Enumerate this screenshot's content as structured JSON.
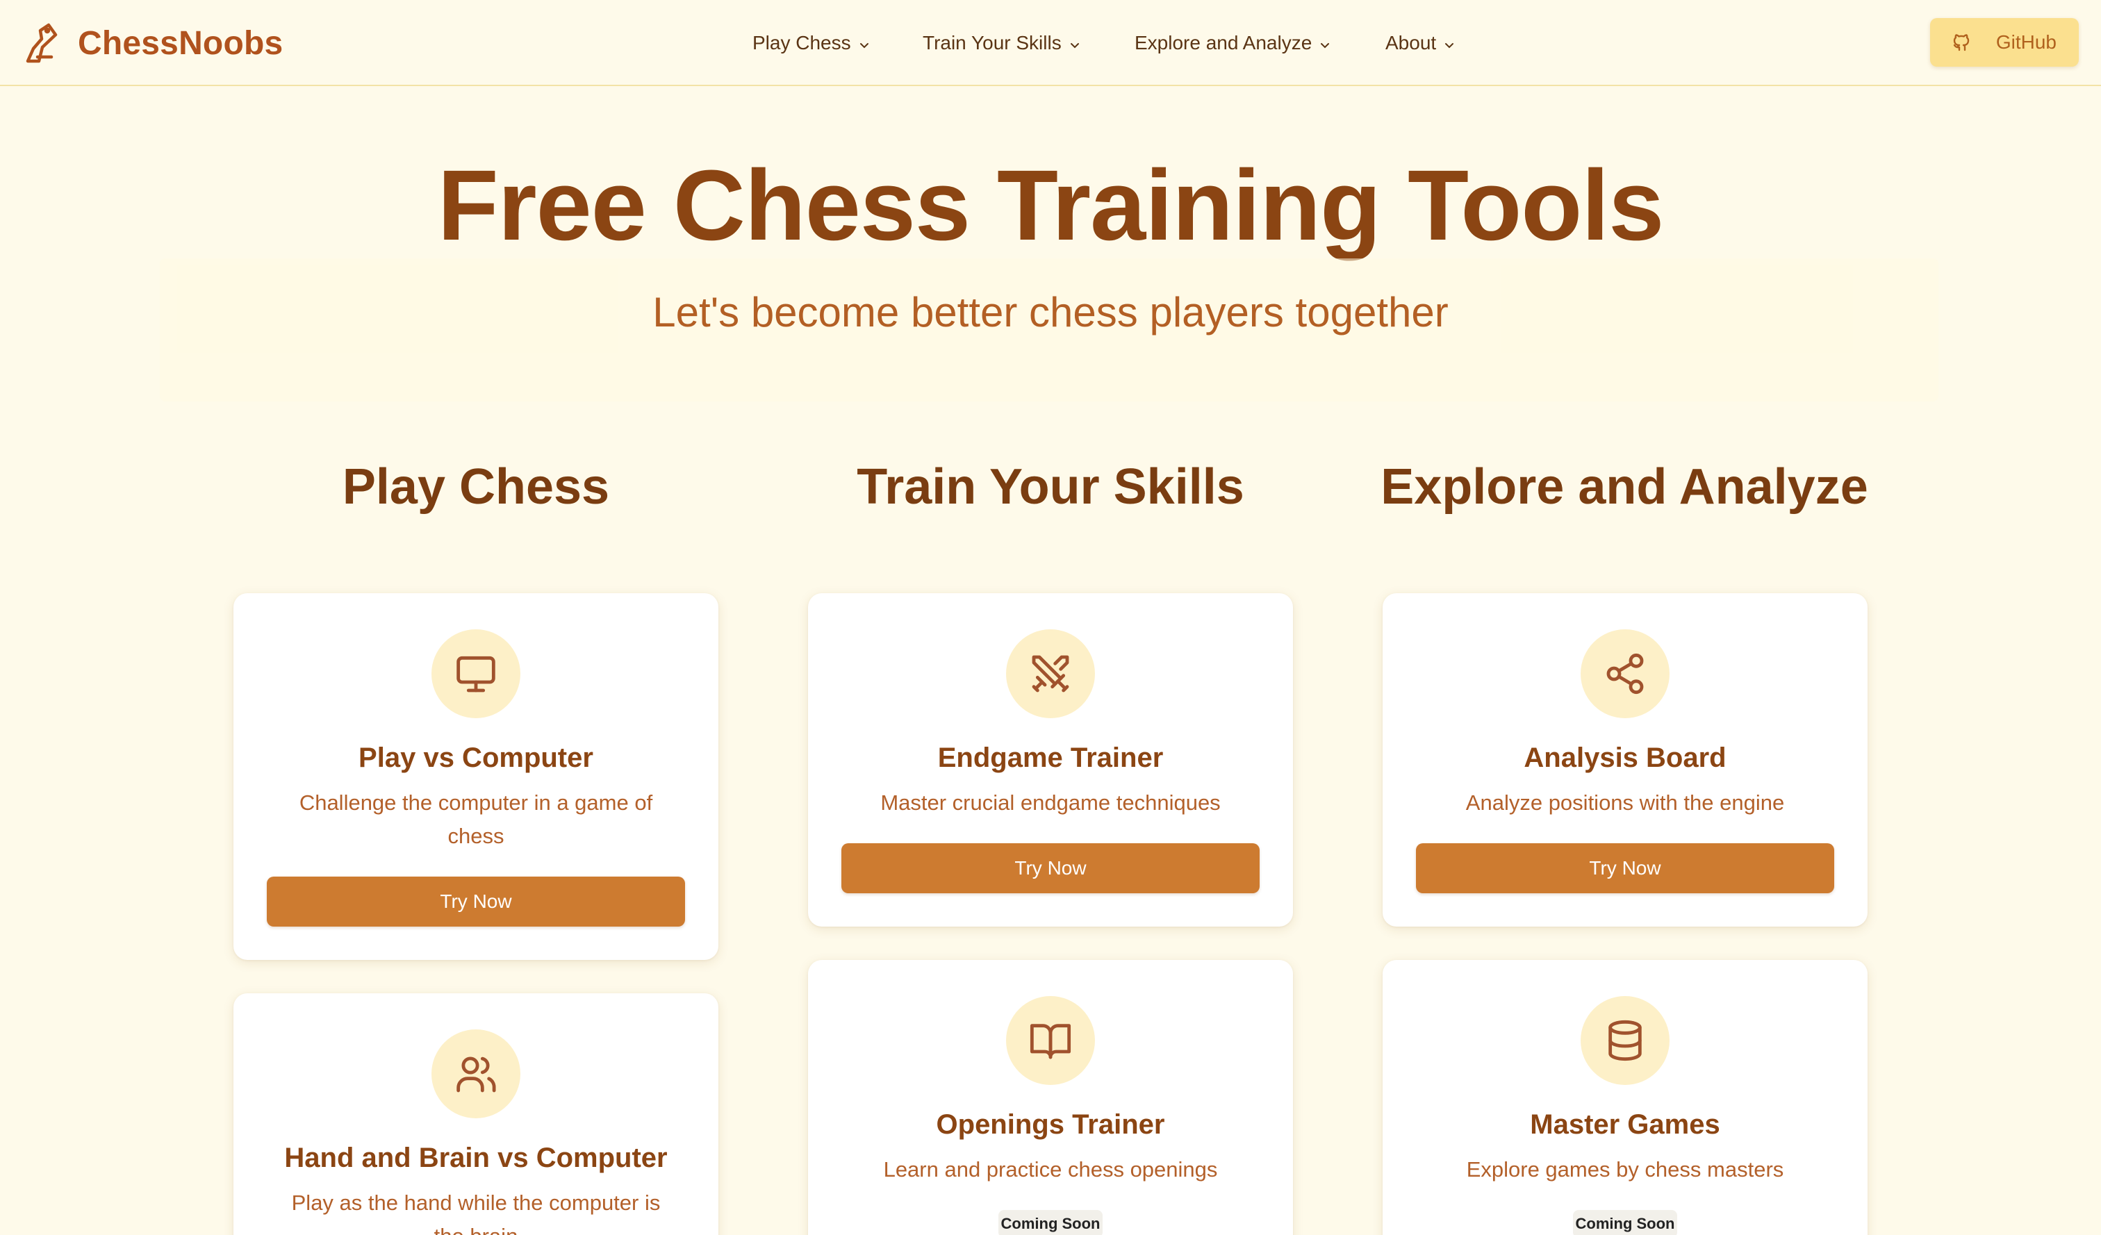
{
  "brand": {
    "name": "ChessNoobs"
  },
  "nav": {
    "items": [
      {
        "label": "Play Chess"
      },
      {
        "label": "Train Your Skills"
      },
      {
        "label": "Explore and Analyze"
      },
      {
        "label": "About"
      }
    ],
    "github_label": "GitHub"
  },
  "hero": {
    "title": "Free Chess Training Tools",
    "subtitle": "Let's become better chess players together"
  },
  "sections": [
    {
      "title": "Play Chess",
      "cards": [
        {
          "icon": "monitor-icon",
          "title": "Play vs Computer",
          "desc": "Challenge the computer in a game of chess",
          "action": "Try Now"
        },
        {
          "icon": "users-icon",
          "title": "Hand and Brain vs Computer",
          "desc": "Play as the hand while the computer is the brain"
        }
      ]
    },
    {
      "title": "Train Your Skills",
      "cards": [
        {
          "icon": "crossed-swords-icon",
          "title": "Endgame Trainer",
          "desc": "Master crucial endgame techniques",
          "action": "Try Now"
        },
        {
          "icon": "open-book-icon",
          "title": "Openings Trainer",
          "desc": "Learn and practice chess openings",
          "badge": "Coming Soon"
        }
      ]
    },
    {
      "title": "Explore and Analyze",
      "cards": [
        {
          "icon": "share-icon",
          "title": "Analysis Board",
          "desc": "Analyze positions with the engine",
          "action": "Try Now"
        },
        {
          "icon": "database-icon",
          "title": "Master Games",
          "desc": "Explore games by chess masters",
          "badge": "Coming Soon"
        }
      ]
    }
  ],
  "colors": {
    "background": "#fefaea",
    "brand": "#b0521d",
    "heading": "#8b4513",
    "button": "#cd7b30",
    "icon_circle": "#fdf0c8",
    "github_button": "#fbe08f"
  }
}
